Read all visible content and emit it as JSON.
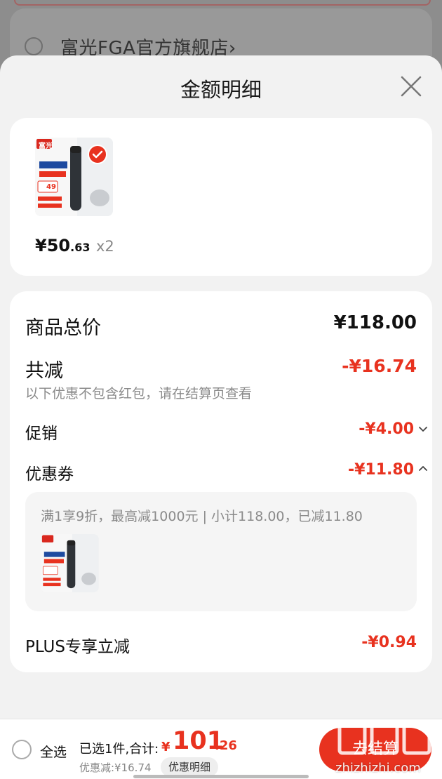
{
  "background": {
    "shop_name": "富光FGA官方旗舰店",
    "shop_chevron": "›"
  },
  "sheet": {
    "title": "金额明细",
    "close_icon": "close-icon"
  },
  "product": {
    "price_int": "¥50",
    "price_dec": ".63",
    "quantity": "x2",
    "thumb_brand": "富光",
    "thumb_price": "49",
    "selected_badge": "check-icon"
  },
  "breakdown": {
    "total_label": "商品总价",
    "total_value": "¥118.00",
    "reduce_label": "共减",
    "reduce_value": "-¥16.74",
    "note": "以下优惠不包含红包，请在结算页查看",
    "promo_label": "促销",
    "promo_value": "-¥4.00",
    "coupon_label": "优惠券",
    "coupon_value": "-¥11.80",
    "coupon_detail": "满1享9折，最高减1000元 | 小计118.00，已减11.80",
    "plus_label": "PLUS专享立减",
    "plus_value": "-¥0.94"
  },
  "bottom_bar": {
    "select_all": "全选",
    "selected_info": "已选1件,合计:",
    "sum_yen": "¥",
    "sum_int": "101",
    "sum_dec": ".26",
    "discount_line": "优惠减:¥16.74",
    "detail_button": "优惠明细",
    "checkout_button": "去结算",
    "watermark": "zhizhizhi.com"
  },
  "colors": {
    "accent": "#e8321f",
    "sheet_bg": "#f2f2f2",
    "card_bg": "#ffffff",
    "muted_text": "#8a8a8a"
  }
}
